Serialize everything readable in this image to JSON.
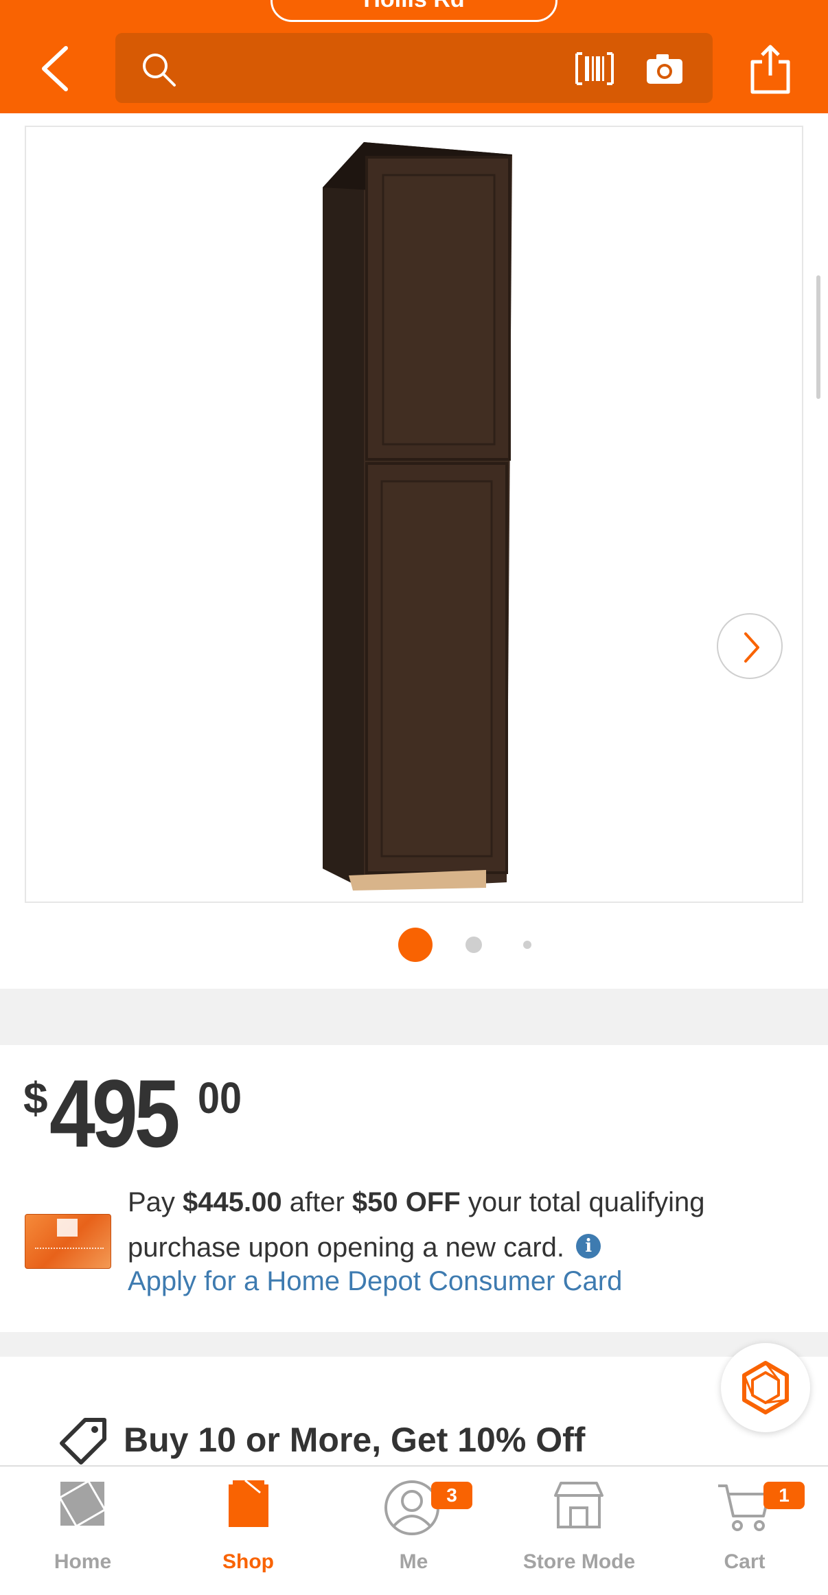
{
  "header": {
    "store_label": "Hollis Rd",
    "search_placeholder": "",
    "icons": [
      "back-arrow-icon",
      "search-icon",
      "barcode-icon",
      "camera-icon",
      "share-icon"
    ]
  },
  "gallery": {
    "image_alt": "Dark brown pantry cabinet",
    "slide_count": 3,
    "active_slide": 1
  },
  "price": {
    "dollar_sign": "$",
    "whole": "495",
    "cents": "00"
  },
  "card_offer": {
    "pay_prefix": "Pay ",
    "pay_amount": "$445.00",
    "after": " after ",
    "discount": "$50 OFF",
    "rest": " your total qualifying purchase upon opening a new card.",
    "info_glyph": "i",
    "apply_link": "Apply for a Home Depot Consumer Card"
  },
  "promo": {
    "headline": "Buy 10 or More, Get 10% Off"
  },
  "nav": {
    "items": [
      {
        "label": "Home",
        "icon": "home-depot-logo-icon"
      },
      {
        "label": "Shop",
        "icon": "shop-bag-icon"
      },
      {
        "label": "Me",
        "icon": "person-icon",
        "badge": "3"
      },
      {
        "label": "Store Mode",
        "icon": "store-icon"
      },
      {
        "label": "Cart",
        "icon": "cart-icon",
        "badge": "1"
      }
    ]
  },
  "colors": {
    "brand_orange": "#f96302",
    "link_blue": "#3e7bb0",
    "text_dark": "#333333"
  }
}
